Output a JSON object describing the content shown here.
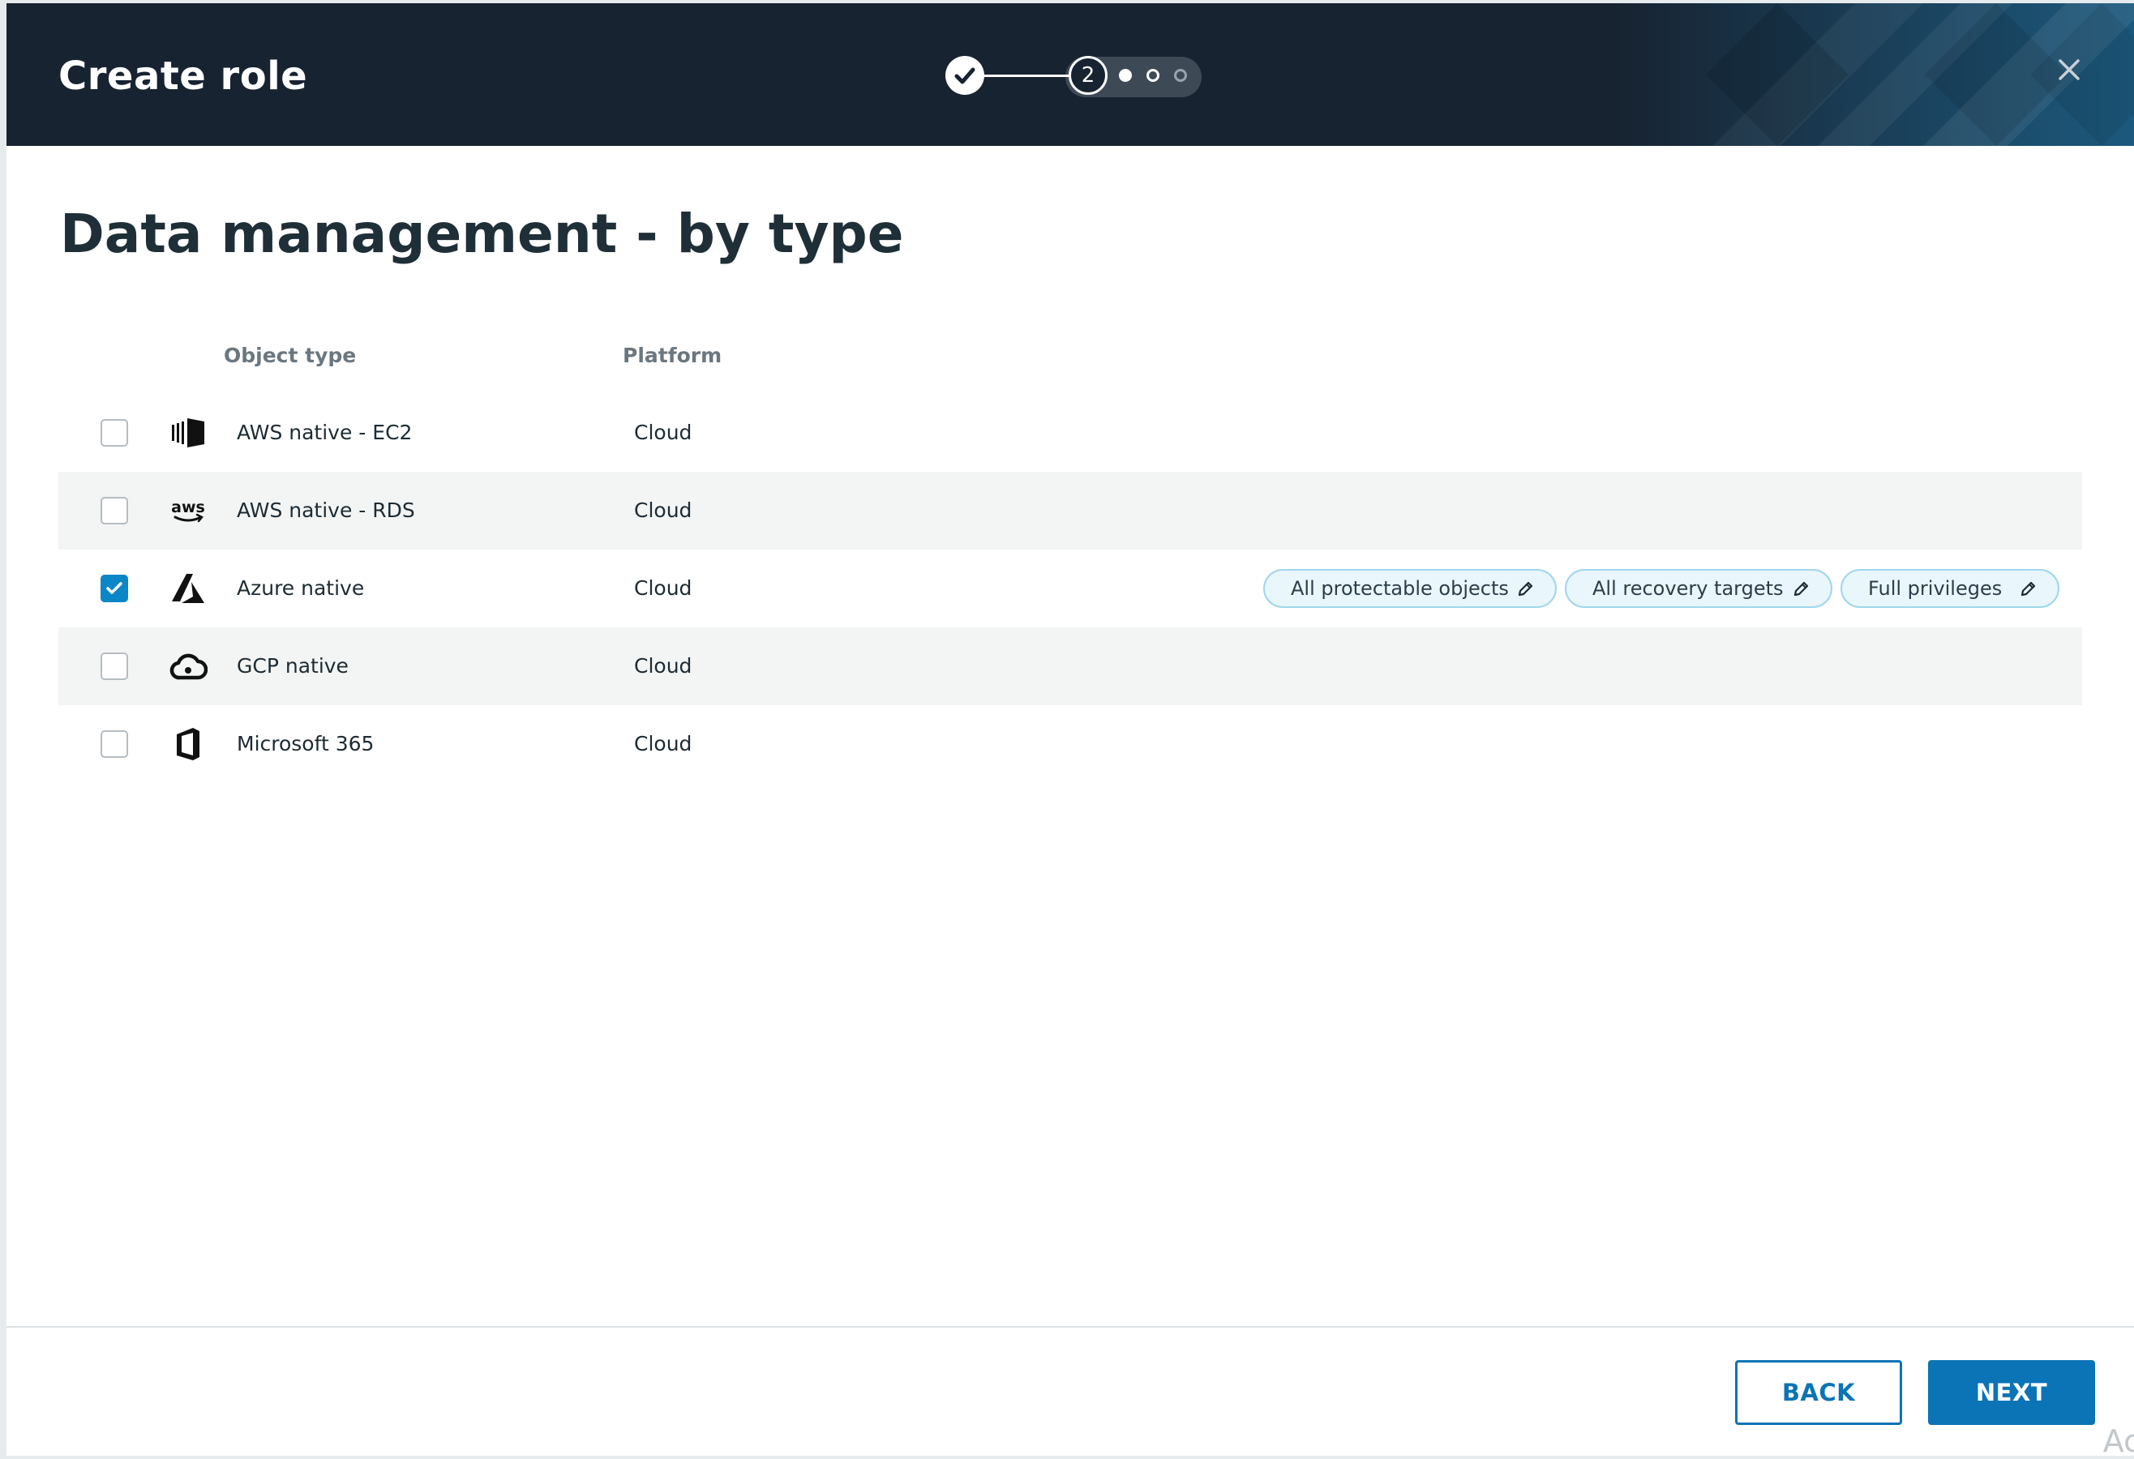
{
  "header": {
    "title": "Create role",
    "close_icon": "close-icon",
    "stepper": {
      "current_step_label": "2",
      "completed_icon": "check-icon"
    }
  },
  "main": {
    "title": "Data management - by type",
    "table": {
      "columns": [
        "Object type",
        "Platform"
      ],
      "rows": [
        {
          "name": "AWS native - EC2",
          "platform": "Cloud",
          "icon": "aws-ec2-icon",
          "checked": false
        },
        {
          "name": "AWS native - RDS",
          "platform": "Cloud",
          "icon": "aws-icon",
          "checked": false
        },
        {
          "name": "Azure native",
          "platform": "Cloud",
          "icon": "azure-icon",
          "checked": true,
          "tags": [
            "All protectable objects",
            "All recovery targets",
            "Full privileges"
          ]
        },
        {
          "name": "GCP native",
          "platform": "Cloud",
          "icon": "gcp-cloud-icon",
          "checked": false
        },
        {
          "name": "Microsoft 365",
          "platform": "Cloud",
          "icon": "office-icon",
          "checked": false
        }
      ]
    }
  },
  "footer": {
    "back_label": "BACK",
    "next_label": "NEXT",
    "corner_text": "Ac"
  },
  "colors": {
    "header_bg": "#172331",
    "accent": "#0b74b6",
    "checkbox_checked": "#0b86c7",
    "tag_bg": "#e9f6fc",
    "tag_border": "#9fd6ee"
  }
}
